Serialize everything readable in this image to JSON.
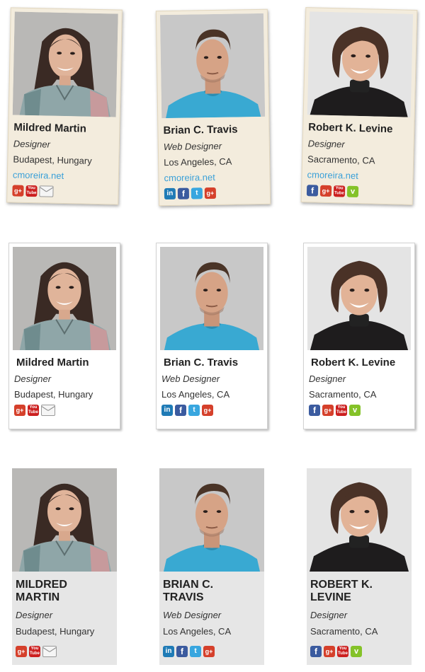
{
  "people": [
    {
      "name": "Mildred Martin",
      "role": "Designer",
      "location": "Budapest, Hungary",
      "website": "cmoreira.net"
    },
    {
      "name": "Brian C. Travis",
      "role": "Web Designer",
      "location": "Los Angeles, CA",
      "website": "cmoreira.net"
    },
    {
      "name": "Robert K. Levine",
      "role": "Designer",
      "location": "Sacramento, CA",
      "website": "cmoreira.net"
    }
  ],
  "icons": {
    "gplus": "g+",
    "youtube_top": "You",
    "youtube_bottom": "Tube",
    "linkedin": "in",
    "facebook": "f",
    "twitter": "t",
    "vimeo": "v"
  }
}
